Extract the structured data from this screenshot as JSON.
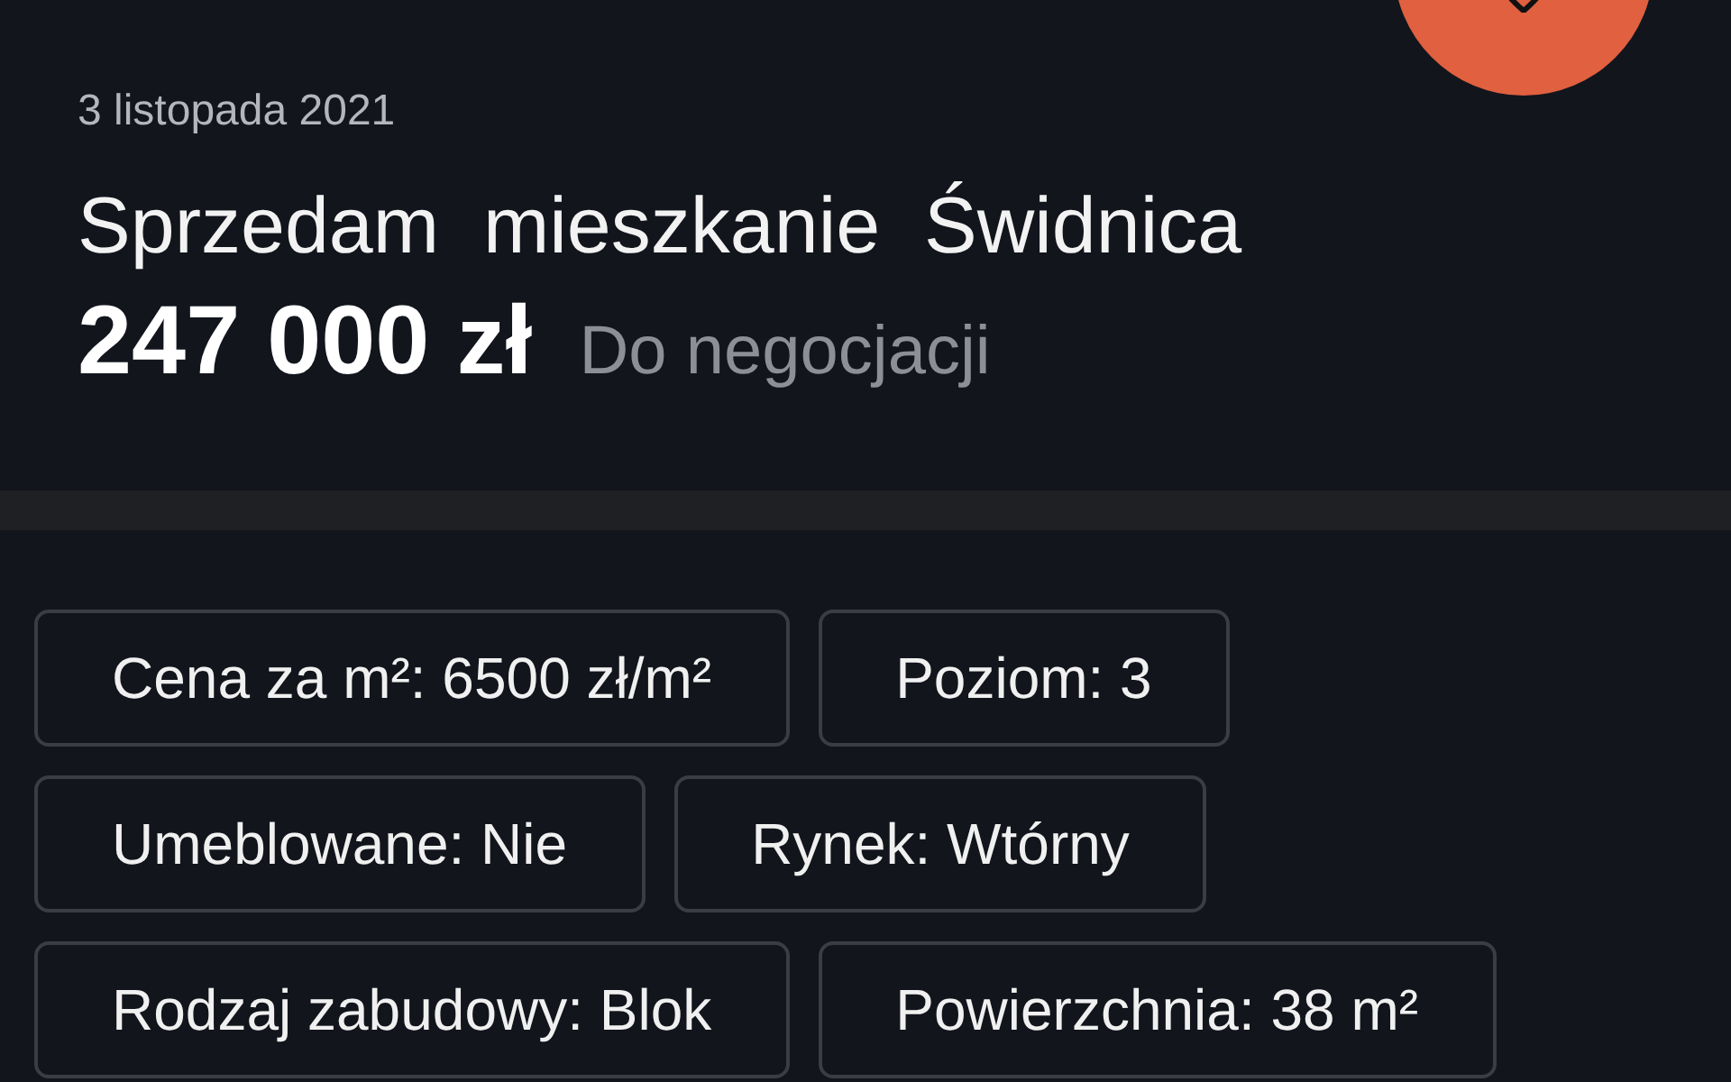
{
  "date": "3 listopada 2021",
  "title": "Sprzedam  mieszkanie  Świdnica",
  "price": "247 000 zł",
  "negotiable": "Do negocjacji",
  "favorite": {
    "on": false
  },
  "params": [
    {
      "label": "Cena za m²: 6500 zł/m²"
    },
    {
      "label": "Poziom: 3"
    },
    {
      "label": "Umeblowane: Nie"
    },
    {
      "label": "Rynek: Wtórny"
    },
    {
      "label": "Rodzaj zabudowy: Blok"
    },
    {
      "label": "Powierzchnia: 38 m²"
    }
  ]
}
